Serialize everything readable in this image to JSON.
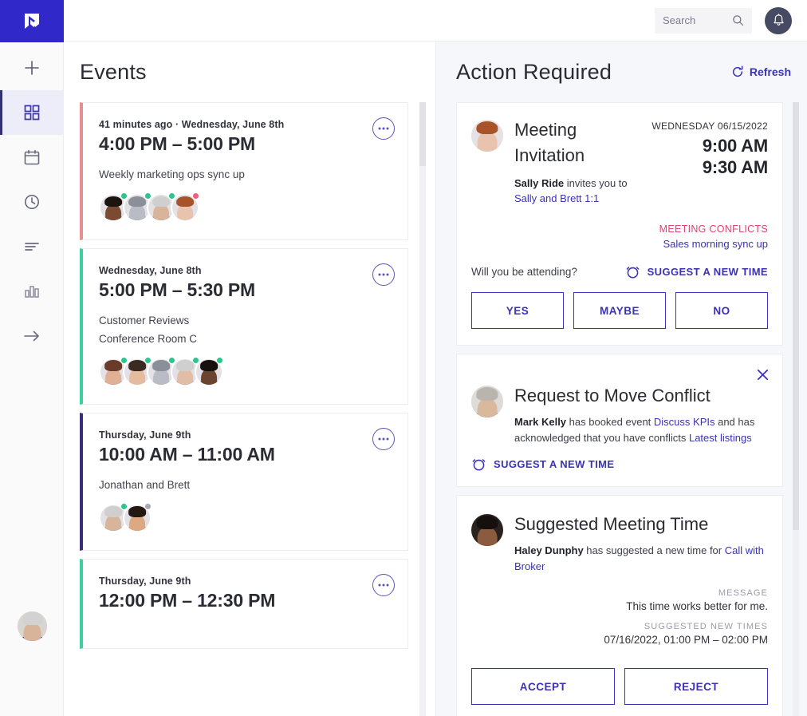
{
  "brand": {
    "logo_icon": "logo-checkmark-icon",
    "logo_color": "#3028c8",
    "accent": "#3b32b5",
    "danger": "#e0426e",
    "online": "#2fc48d",
    "busy": "#f0607e",
    "away": "#a9a9b6"
  },
  "topbar": {
    "search": {
      "placeholder": "Search",
      "value": "",
      "icon": "search-icon"
    },
    "notifications_icon": "bell-icon"
  },
  "sidebar": {
    "items": [
      {
        "icon": "plus-icon",
        "name": "add",
        "active": false
      },
      {
        "icon": "grid-dashboard-icon",
        "name": "dashboard",
        "active": true
      },
      {
        "icon": "calendar-icon",
        "name": "calendar",
        "active": false
      },
      {
        "icon": "clock-icon",
        "name": "history",
        "active": false
      },
      {
        "icon": "list-lines-icon",
        "name": "agenda",
        "active": false
      },
      {
        "icon": "bar-chart-icon",
        "name": "analytics",
        "active": false
      },
      {
        "icon": "arrow-right-icon",
        "name": "expand",
        "active": false
      }
    ],
    "user_avatar": "user-avatar"
  },
  "events": {
    "title": "Events",
    "cards": [
      {
        "meta": "41 minutes ago  ·  Wednesday, June 8th",
        "time": "4:00 PM – 5:00 PM",
        "lines": [
          "Weekly marketing ops sync up"
        ],
        "accent": "#e98e8e",
        "more_icon": "more-dots-icon",
        "attendees": [
          {
            "status": "#2fc48d",
            "skin": "#7a4a32",
            "hair": "#1c1410",
            "shirt": "#2b2b38"
          },
          {
            "status": "#2fc48d",
            "skin": "#b9bcc4",
            "hair": "#8a8f99",
            "shirt": "#3146c0"
          },
          {
            "status": "#2fc48d",
            "skin": "#d8b49a",
            "hair": "#cfcfcf",
            "shirt": "#2f3a6b"
          },
          {
            "status": "#f0607e",
            "skin": "#e8c3ad",
            "hair": "#a8532a",
            "shirt": "#e3e0e2"
          }
        ]
      },
      {
        "meta": "Wednesday, June 8th",
        "time": "5:00 PM – 5:30 PM",
        "lines": [
          "Customer Reviews",
          "Conference Room C"
        ],
        "accent": "#3ecfa0",
        "more_icon": "more-dots-icon",
        "attendees": [
          {
            "status": "#2fc48d",
            "skin": "#dfb093",
            "hair": "#6b3b2a",
            "shirt": "#5a2a5e"
          },
          {
            "status": "#2fc48d",
            "skin": "#e4bb9c",
            "hair": "#3a2a22",
            "shirt": "#cdd3dd"
          },
          {
            "status": "#2fc48d",
            "skin": "#b9bcc4",
            "hair": "#8a8f99",
            "shirt": "#9aa0aa"
          },
          {
            "status": "#2fc48d",
            "skin": "#e0bda4",
            "hair": "#cfcfcf",
            "shirt": "#24537e"
          },
          {
            "status": "#2fc48d",
            "skin": "#6b4430",
            "hair": "#17100c",
            "shirt": "#2a2420"
          }
        ]
      },
      {
        "meta": "Thursday, June 9th",
        "time": "10:00 AM – 11:00 AM",
        "lines": [
          "Jonathan and Brett"
        ],
        "accent": "#3c2f7a",
        "more_icon": "more-dots-icon",
        "attendees": [
          {
            "status": "#2fc48d",
            "skin": "#d8b49a",
            "hair": "#cfcfcf",
            "shirt": "#3146c0"
          },
          {
            "status": "#a9a9b6",
            "skin": "#dca982",
            "hair": "#241812",
            "shirt": "#9c2f2f"
          }
        ]
      },
      {
        "meta": "Thursday, June 9th",
        "time": "12:00 PM – 12:30 PM",
        "lines": [],
        "accent": "#3ecfa0",
        "more_icon": "more-dots-icon",
        "attendees": []
      }
    ]
  },
  "action_required": {
    "title": "Action Required",
    "refresh": {
      "label": "Refresh",
      "icon": "refresh-icon"
    },
    "invitation": {
      "title": "Meeting Invitation",
      "avatar": "sally-ride-avatar",
      "sub_bold": "Sally Ride",
      "sub_text": " invites you to",
      "sub_link": "Sally and Brett 1:1",
      "date": "WEDNESDAY 06/15/2022",
      "start_time": "9:00 AM",
      "end_time": "9:30 AM",
      "conflicts_label": "MEETING CONFLICTS",
      "conflict_item": "Sales morning sync up",
      "attending_question": "Will you be attending?",
      "suggest_label": "SUGGEST A NEW TIME",
      "suggest_icon": "alarm-clock-icon",
      "buttons": [
        "YES",
        "MAYBE",
        "NO"
      ]
    },
    "move_conflict": {
      "title": "Request to Move Conflict",
      "avatar": "mark-kelly-avatar",
      "close_icon": "close-icon",
      "body_bold": "Mark Kelly",
      "body_text_1": " has booked event ",
      "body_link_1": "Discuss KPIs",
      "body_text_2": " and has acknowledged that you have conflicts ",
      "body_link_2": "Latest listings",
      "suggest_label": "SUGGEST A NEW TIME",
      "suggest_icon": "alarm-clock-icon"
    },
    "suggested_time": {
      "title": "Suggested Meeting Time",
      "avatar": "haley-dunphy-avatar",
      "body_bold": "Haley Dunphy",
      "body_text": " has suggested a new time for ",
      "body_link": "Call with Broker",
      "message_label": "MESSAGE",
      "message_value": "This time works better for me.",
      "times_label": "SUGGESTED NEW TIMES",
      "times_value": "07/16/2022, 01:00 PM – 02:00 PM",
      "buttons": [
        "ACCEPT",
        "REJECT"
      ]
    }
  }
}
